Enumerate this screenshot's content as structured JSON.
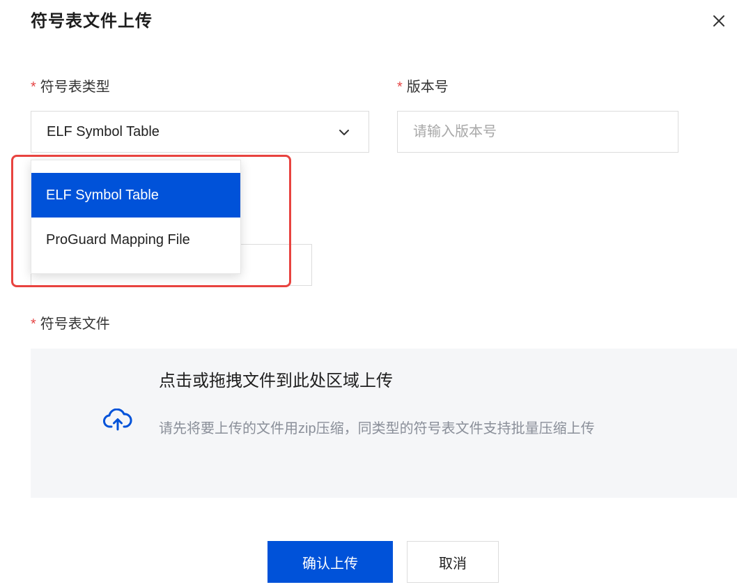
{
  "dialog": {
    "title": "符号表文件上传",
    "close_icon": "close-icon"
  },
  "form": {
    "symbol_type": {
      "required_mark": "*",
      "label": "符号表类型",
      "selected_value": "ELF Symbol Table",
      "dropdown_open": true,
      "options": [
        {
          "label": "ELF Symbol Table",
          "selected": true
        },
        {
          "label": "ProGuard Mapping File",
          "selected": false
        }
      ]
    },
    "version": {
      "required_mark": "*",
      "label": "版本号",
      "value": "",
      "placeholder": "请输入版本号"
    },
    "symbol_file": {
      "required_mark": "*",
      "label": "符号表文件",
      "upload_title": "点击或拖拽文件到此处区域上传",
      "upload_hint": "请先将要上传的文件用zip压缩，同类型的符号表文件支持批量压缩上传",
      "upload_icon": "cloud-upload-icon"
    }
  },
  "actions": {
    "confirm_label": "确认上传",
    "cancel_label": "取消"
  },
  "colors": {
    "primary": "#0052d9",
    "required": "#e54545",
    "highlight_frame": "#e8433f",
    "upload_bg": "#f5f6f8"
  }
}
